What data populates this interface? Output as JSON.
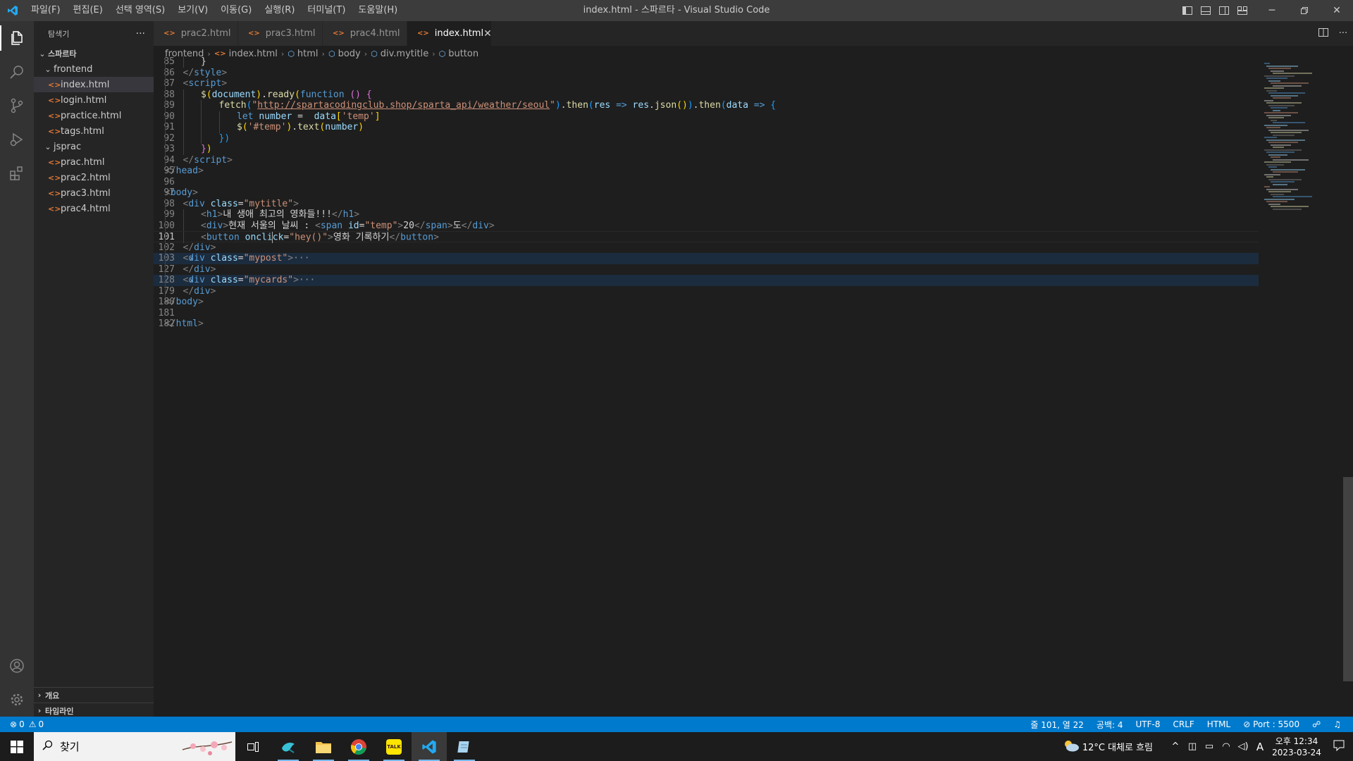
{
  "window": {
    "title": "index.html - 스파르타 - Visual Studio Code",
    "menu": [
      "파일(F)",
      "편집(E)",
      "선택 영역(S)",
      "보기(V)",
      "이동(G)",
      "실행(R)",
      "터미널(T)",
      "도움말(H)"
    ]
  },
  "sidebar": {
    "title": "탐색기",
    "more": "···",
    "root": "스파르타",
    "folders": [
      {
        "name": "frontend",
        "files": [
          "index.html",
          "login.html",
          "practice.html",
          "tags.html"
        ]
      },
      {
        "name": "jsprac",
        "files": [
          "prac.html",
          "prac2.html",
          "prac3.html",
          "prac4.html"
        ]
      }
    ],
    "selected_file": "index.html",
    "sections": [
      "개요",
      "타임라인"
    ]
  },
  "tabs": [
    {
      "label": "prac2.html"
    },
    {
      "label": "prac3.html"
    },
    {
      "label": "prac4.html"
    },
    {
      "label": "index.html",
      "active": true
    }
  ],
  "breadcrumb": [
    "frontend",
    "index.html",
    "html",
    "body",
    "div.mytitle",
    "button"
  ],
  "editor": {
    "current_line": "101",
    "lines": [
      {
        "n": "85",
        "indent": 2,
        "tokens": [
          [
            "t-text",
            "}"
          ]
        ]
      },
      {
        "n": "86",
        "indent": 1,
        "tokens": [
          [
            "t-br",
            "</"
          ],
          [
            "t-tag",
            "style"
          ],
          [
            "t-br",
            ">"
          ]
        ]
      },
      {
        "n": "87",
        "indent": 1,
        "tokens": [
          [
            "t-br",
            "<"
          ],
          [
            "t-tag",
            "script"
          ],
          [
            "t-br",
            ">"
          ]
        ]
      },
      {
        "n": "88",
        "indent": 2,
        "tokens": [
          [
            "t-fn",
            "$"
          ],
          [
            "t-p1",
            "("
          ],
          [
            "t-attr",
            "document"
          ],
          [
            "t-p1",
            ")"
          ],
          [
            "t-text",
            "."
          ],
          [
            "t-fn",
            "ready"
          ],
          [
            "t-p1",
            "("
          ],
          [
            "t-kw",
            "function"
          ],
          [
            "t-text",
            " "
          ],
          [
            "t-p2",
            "()"
          ],
          [
            "t-text",
            " "
          ],
          [
            "t-p2",
            "{"
          ]
        ]
      },
      {
        "n": "89",
        "indent": 3,
        "tokens": [
          [
            "t-fn",
            "fetch"
          ],
          [
            "t-p3",
            "("
          ],
          [
            "t-str",
            "\""
          ],
          [
            "t-url",
            "http://spartacodingclub.shop/sparta_api/weather/seoul"
          ],
          [
            "t-str",
            "\""
          ],
          [
            "t-p3",
            ")"
          ],
          [
            "t-text",
            "."
          ],
          [
            "t-fn",
            "then"
          ],
          [
            "t-p3",
            "("
          ],
          [
            "t-attr",
            "res"
          ],
          [
            "t-text",
            " "
          ],
          [
            "t-kw",
            "=>"
          ],
          [
            "t-text",
            " "
          ],
          [
            "t-attr",
            "res"
          ],
          [
            "t-text",
            "."
          ],
          [
            "t-fn",
            "json"
          ],
          [
            "t-p1",
            "()"
          ],
          [
            "t-p3",
            ")"
          ],
          [
            "t-text",
            "."
          ],
          [
            "t-fn",
            "then"
          ],
          [
            "t-p3",
            "("
          ],
          [
            "t-attr",
            "data"
          ],
          [
            "t-text",
            " "
          ],
          [
            "t-kw",
            "=>"
          ],
          [
            "t-text",
            " "
          ],
          [
            "t-p3",
            "{"
          ]
        ]
      },
      {
        "n": "90",
        "indent": 4,
        "tokens": [
          [
            "t-kw",
            "let"
          ],
          [
            "t-text",
            " "
          ],
          [
            "t-attr",
            "number"
          ],
          [
            "t-text",
            " =  "
          ],
          [
            "t-attr",
            "data"
          ],
          [
            "t-p1",
            "["
          ],
          [
            "t-str",
            "'temp'"
          ],
          [
            "t-p1",
            "]"
          ]
        ]
      },
      {
        "n": "91",
        "indent": 4,
        "tokens": [
          [
            "t-fn",
            "$"
          ],
          [
            "t-p1",
            "("
          ],
          [
            "t-str",
            "'#temp'"
          ],
          [
            "t-p1",
            ")"
          ],
          [
            "t-text",
            "."
          ],
          [
            "t-fn",
            "text"
          ],
          [
            "t-p1",
            "("
          ],
          [
            "t-attr",
            "number"
          ],
          [
            "t-p1",
            ")"
          ]
        ]
      },
      {
        "n": "92",
        "indent": 3,
        "tokens": [
          [
            "t-p3",
            "})"
          ]
        ]
      },
      {
        "n": "93",
        "indent": 2,
        "tokens": [
          [
            "t-p2",
            "}"
          ],
          [
            "t-p1",
            ")"
          ]
        ]
      },
      {
        "n": "94",
        "indent": 1,
        "tokens": [
          [
            "t-br",
            "</"
          ],
          [
            "t-tag",
            "script"
          ],
          [
            "t-br",
            ">"
          ]
        ]
      },
      {
        "n": "95",
        "indent": 0,
        "tokens": [
          [
            "t-br",
            "</"
          ],
          [
            "t-tag",
            "head"
          ],
          [
            "t-br",
            ">"
          ]
        ]
      },
      {
        "n": "96",
        "indent": 0,
        "tokens": []
      },
      {
        "n": "97",
        "indent": 0,
        "tokens": [
          [
            "t-br",
            "<"
          ],
          [
            "t-tag",
            "body"
          ],
          [
            "t-br",
            ">"
          ]
        ]
      },
      {
        "n": "98",
        "indent": 1,
        "tokens": [
          [
            "t-br",
            "<"
          ],
          [
            "t-tag",
            "div"
          ],
          [
            "t-text",
            " "
          ],
          [
            "t-attr",
            "class"
          ],
          [
            "t-text",
            "="
          ],
          [
            "t-str",
            "\"mytitle\""
          ],
          [
            "t-br",
            ">"
          ]
        ]
      },
      {
        "n": "99",
        "indent": 2,
        "tokens": [
          [
            "t-br",
            "<"
          ],
          [
            "t-tag",
            "h1"
          ],
          [
            "t-br",
            ">"
          ],
          [
            "t-text",
            "내 생애 최고의 영화들!!!"
          ],
          [
            "t-br",
            "</"
          ],
          [
            "t-tag",
            "h1"
          ],
          [
            "t-br",
            ">"
          ]
        ]
      },
      {
        "n": "100",
        "indent": 2,
        "tokens": [
          [
            "t-br",
            "<"
          ],
          [
            "t-tag",
            "div"
          ],
          [
            "t-br",
            ">"
          ],
          [
            "t-text",
            "현재 서울의 날씨 : "
          ],
          [
            "t-br",
            "<"
          ],
          [
            "t-tag",
            "span"
          ],
          [
            "t-text",
            " "
          ],
          [
            "t-attr",
            "id"
          ],
          [
            "t-text",
            "="
          ],
          [
            "t-str",
            "\"temp\""
          ],
          [
            "t-br",
            ">"
          ],
          [
            "t-text",
            "20"
          ],
          [
            "t-br",
            "</"
          ],
          [
            "t-tag",
            "span"
          ],
          [
            "t-br",
            ">"
          ],
          [
            "t-text",
            "도"
          ],
          [
            "t-br",
            "</"
          ],
          [
            "t-tag",
            "div"
          ],
          [
            "t-br",
            ">"
          ]
        ]
      },
      {
        "n": "101",
        "indent": 2,
        "current": true,
        "tokens": [
          [
            "t-br",
            "<"
          ],
          [
            "t-tag",
            "button"
          ],
          [
            "t-text",
            " "
          ],
          [
            "t-attr",
            "oncli"
          ],
          [
            "cursor",
            ""
          ],
          [
            "t-attr",
            "ck"
          ],
          [
            "t-text",
            "="
          ],
          [
            "t-str",
            "\"hey()\""
          ],
          [
            "t-br",
            ">"
          ],
          [
            "t-text",
            "영화 기록하기"
          ],
          [
            "t-br",
            "</"
          ],
          [
            "t-tag",
            "button"
          ],
          [
            "t-br",
            ">"
          ]
        ]
      },
      {
        "n": "102",
        "indent": 1,
        "tokens": [
          [
            "t-br",
            "</"
          ],
          [
            "t-tag",
            "div"
          ],
          [
            "t-br",
            ">"
          ]
        ]
      },
      {
        "n": "103",
        "indent": 1,
        "folded": true,
        "tokens": [
          [
            "t-br",
            "<"
          ],
          [
            "t-tag",
            "div"
          ],
          [
            "t-text",
            " "
          ],
          [
            "t-attr",
            "class"
          ],
          [
            "t-text",
            "="
          ],
          [
            "t-str",
            "\"mypost\""
          ],
          [
            "t-br",
            ">"
          ],
          [
            "t-fold",
            "···"
          ]
        ]
      },
      {
        "n": "127",
        "indent": 1,
        "tokens": [
          [
            "t-br",
            "</"
          ],
          [
            "t-tag",
            "div"
          ],
          [
            "t-br",
            ">"
          ]
        ]
      },
      {
        "n": "128",
        "indent": 1,
        "folded": true,
        "tokens": [
          [
            "t-br",
            "<"
          ],
          [
            "t-tag",
            "div"
          ],
          [
            "t-text",
            " "
          ],
          [
            "t-attr",
            "class"
          ],
          [
            "t-text",
            "="
          ],
          [
            "t-str",
            "\"mycards\""
          ],
          [
            "t-br",
            ">"
          ],
          [
            "t-fold",
            "···"
          ]
        ]
      },
      {
        "n": "179",
        "indent": 1,
        "tokens": [
          [
            "t-br",
            "</"
          ],
          [
            "t-tag",
            "div"
          ],
          [
            "t-br",
            ">"
          ]
        ]
      },
      {
        "n": "180",
        "indent": 0,
        "tokens": [
          [
            "t-br",
            "</"
          ],
          [
            "t-tag",
            "body"
          ],
          [
            "t-br",
            ">"
          ]
        ]
      },
      {
        "n": "181",
        "indent": 0,
        "tokens": []
      },
      {
        "n": "182",
        "indent": 0,
        "tokens": [
          [
            "t-br",
            "</"
          ],
          [
            "t-tag",
            "html"
          ],
          [
            "t-br",
            ">"
          ]
        ]
      }
    ]
  },
  "statusbar": {
    "errors": "0",
    "warnings": "0",
    "position": "줄 101, 열 22",
    "spaces": "공백: 4",
    "encoding": "UTF-8",
    "eol": "CRLF",
    "language": "HTML",
    "port": "Port : 5500"
  },
  "taskbar": {
    "search_placeholder": "찾기",
    "weather": "12°C  대체로 흐림",
    "time": "오후 12:34",
    "date": "2023-03-24",
    "ime": "A",
    "talk": "TALK"
  },
  "colors": {
    "accent": "#007acc",
    "titlebar": "#3c3c3c",
    "activitybar": "#333333",
    "sidebar": "#252526",
    "editor": "#1e1e1e"
  }
}
